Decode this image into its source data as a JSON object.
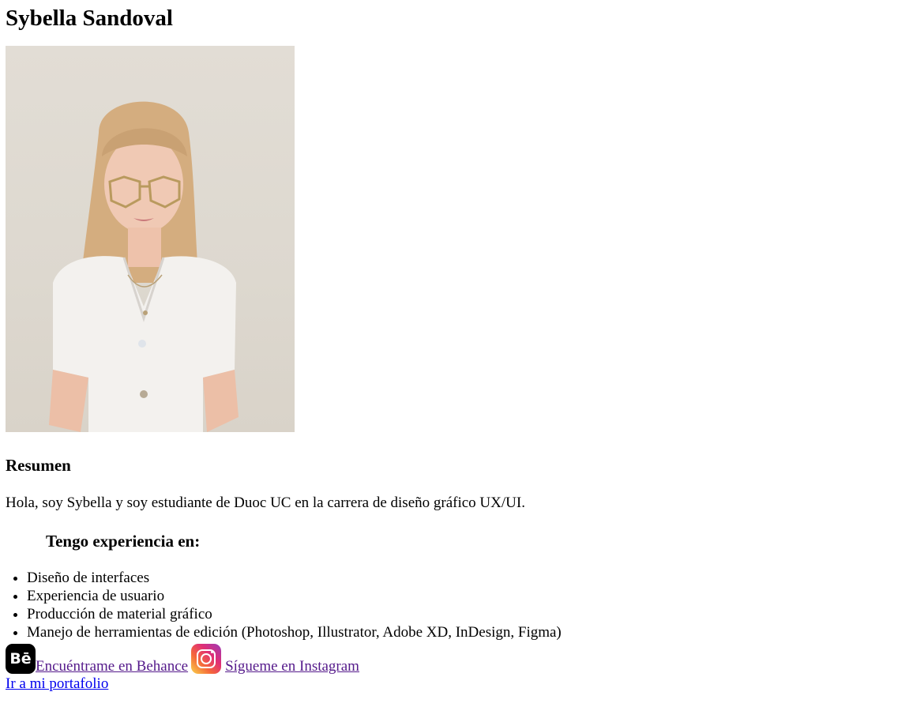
{
  "header": {
    "name": "Sybella Sandoval"
  },
  "profile_photo": {
    "alt": "Sybella Sandoval"
  },
  "summary": {
    "heading": "Resumen",
    "bio": "Hola, soy Sybella y soy estudiante de Duoc UC en la carrera de diseño gráfico UX/UI."
  },
  "experience": {
    "heading": "Tengo experiencia en:",
    "items": [
      "Diseño de interfaces",
      "Experiencia de usuario",
      "Producción de material gráfico",
      "Manejo de herramientas de edición (Photoshop, Illustrator, Adobe XD, InDesign, Figma)"
    ]
  },
  "social": {
    "behance_icon_text": "Bē",
    "behance_label": "Encuéntrame en Behance",
    "instagram_label": "Sígueme en Instagram"
  },
  "portfolio": {
    "label": "Ir a mi portafolio"
  },
  "colors": {
    "link": "#0000ee",
    "visited_link": "#551a8b",
    "photo_background": "#e0dbd3"
  },
  "icons": {
    "behance": "behance-icon",
    "instagram": "instagram-icon"
  }
}
